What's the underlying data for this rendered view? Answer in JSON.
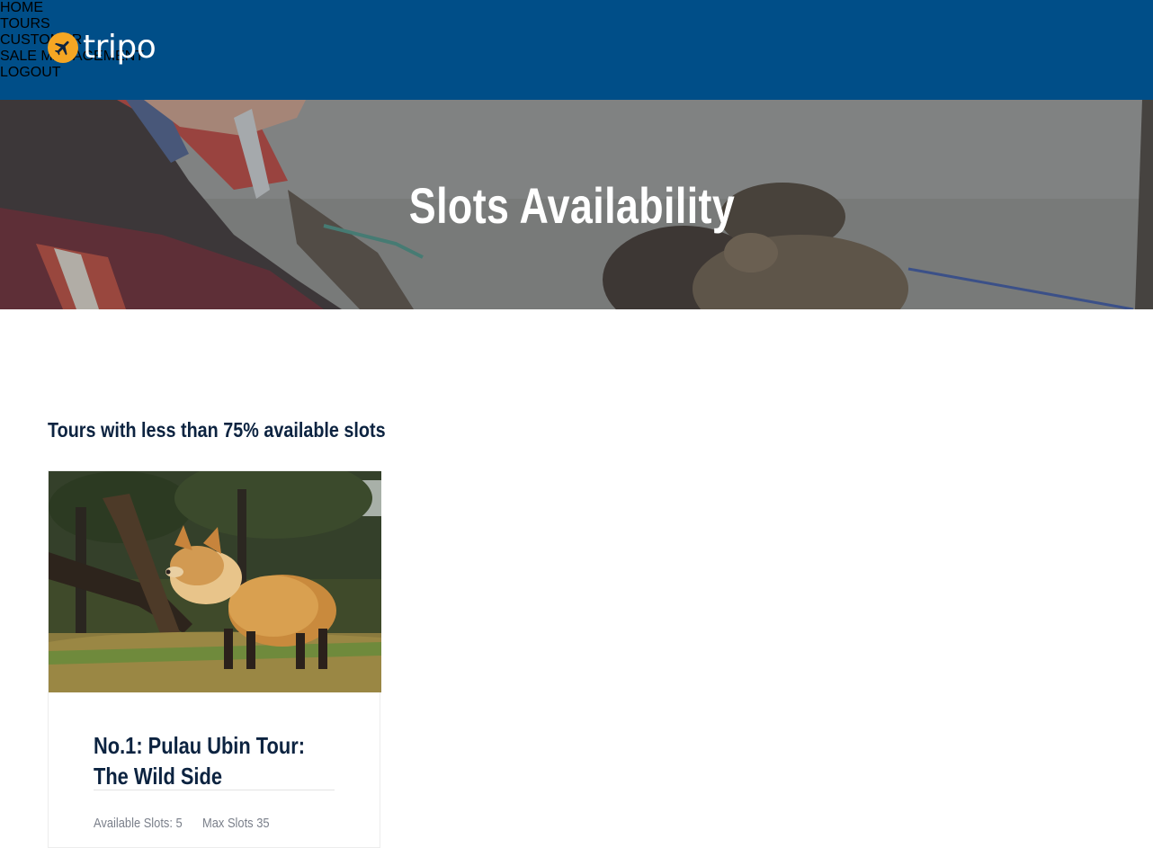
{
  "header": {
    "brand": "tripo",
    "brand_icon": "airplane-icon",
    "accent_color": "#f5a623",
    "background_color": "#004e88",
    "nav": [
      {
        "label": "HOME"
      },
      {
        "label": "TOURS"
      },
      {
        "label": "CUSTOMER"
      },
      {
        "label": "SALE MANAGEMENT"
      },
      {
        "label": "LOGOUT"
      }
    ]
  },
  "hero": {
    "title": "Slots Availability"
  },
  "section": {
    "heading": "Tours with less than 75% available slots"
  },
  "tours": [
    {
      "title": "No.1: Pulau Ubin Tour: The Wild Side",
      "available_label": "Available Slots: 5",
      "max_label": "Max Slots 35"
    }
  ]
}
